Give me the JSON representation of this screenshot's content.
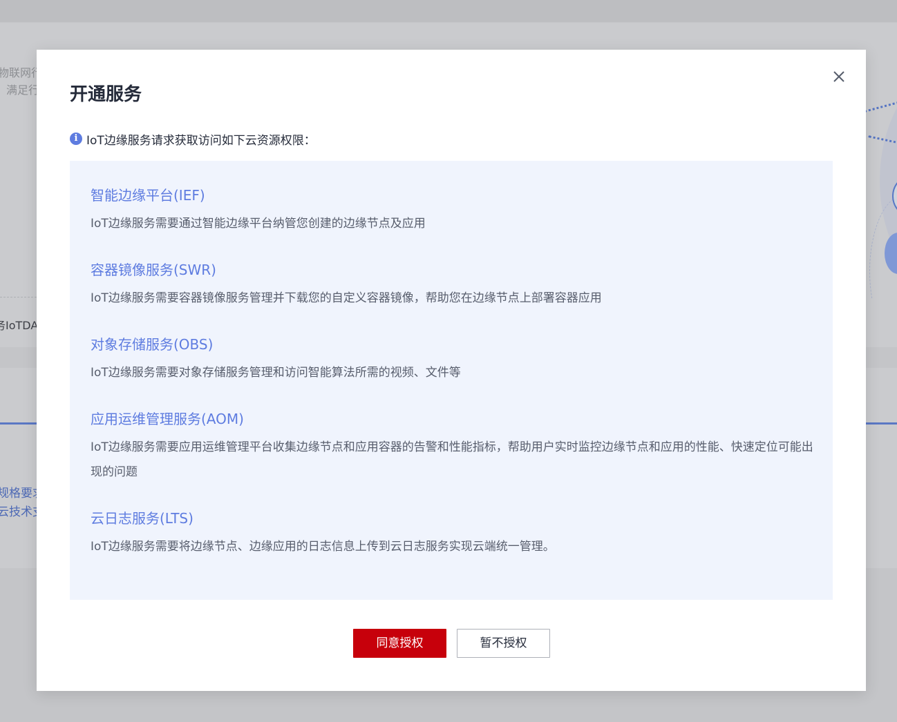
{
  "background": {
    "texts": [
      "物联网行",
      "满足行",
      "务IoTDA",
      "规格要求",
      "云技术支"
    ]
  },
  "modal": {
    "title": "开通服务",
    "info_text": "IoT边缘服务请求获取访问如下云资源权限：",
    "permissions": [
      {
        "name": "智能边缘平台(IEF)",
        "desc": "IoT边缘服务需要通过智能边缘平台纳管您创建的边缘节点及应用"
      },
      {
        "name": "容器镜像服务(SWR)",
        "desc": "IoT边缘服务需要容器镜像服务管理并下载您的自定义容器镜像，帮助您在边缘节点上部署容器应用"
      },
      {
        "name": "对象存储服务(OBS)",
        "desc": "IoT边缘服务需要对象存储服务管理和访问智能算法所需的视频、文件等"
      },
      {
        "name": "应用运维管理服务(AOM)",
        "desc": "IoT边缘服务需要应用运维管理平台收集边缘节点和应用容器的告警和性能指标，帮助用户实时监控边缘节点和应用的性能、快速定位可能出现的问题"
      },
      {
        "name": "云日志服务(LTS)",
        "desc": "IoT边缘服务需要将边缘节点、边缘应用的日志信息上传到云日志服务实现云端统一管理。"
      }
    ],
    "agree_label": "同意授权",
    "decline_label": "暂不授权"
  },
  "colors": {
    "accent": "#5e7ce0",
    "primary_button": "#c7000b",
    "permission_background": "#f0f4fd"
  },
  "icons": {
    "close": "close-icon",
    "info": "info-icon"
  }
}
